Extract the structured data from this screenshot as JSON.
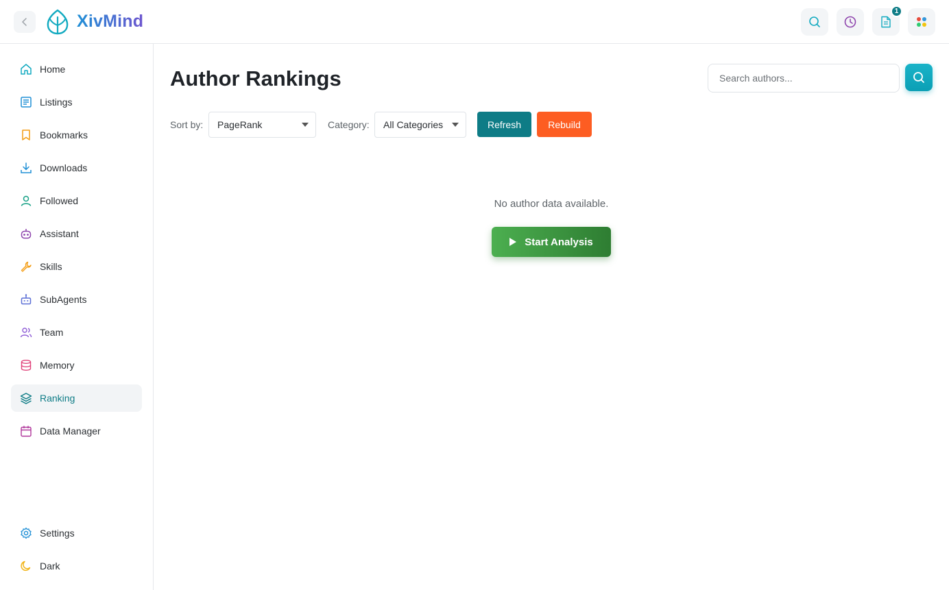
{
  "app": {
    "brand": "XivMind"
  },
  "topbar": {
    "notification_count": "1",
    "icons": [
      "search-icon",
      "history-icon",
      "document-icon",
      "apps-icon"
    ]
  },
  "sidebar": {
    "items": [
      {
        "label": "Home",
        "icon": "home-icon"
      },
      {
        "label": "Listings",
        "icon": "list-icon"
      },
      {
        "label": "Bookmarks",
        "icon": "bookmark-icon"
      },
      {
        "label": "Downloads",
        "icon": "download-icon"
      },
      {
        "label": "Followed",
        "icon": "user-icon"
      },
      {
        "label": "Assistant",
        "icon": "robot-icon"
      },
      {
        "label": "Skills",
        "icon": "wrench-icon"
      },
      {
        "label": "SubAgents",
        "icon": "bot-icon"
      },
      {
        "label": "Team",
        "icon": "team-icon"
      },
      {
        "label": "Memory",
        "icon": "database-icon"
      },
      {
        "label": "Ranking",
        "icon": "layers-icon",
        "active": true
      },
      {
        "label": "Data Manager",
        "icon": "calendar-icon"
      }
    ],
    "footer": [
      {
        "label": "Settings",
        "icon": "gear-icon"
      },
      {
        "label": "Dark",
        "icon": "moon-icon"
      }
    ]
  },
  "main": {
    "title": "Author Rankings",
    "search": {
      "placeholder": "Search authors..."
    },
    "sort_label": "Sort by:",
    "sort_value": "PageRank",
    "category_label": "Category:",
    "category_value": "All Categories",
    "refresh_label": "Refresh",
    "rebuild_label": "Rebuild",
    "empty_message": "No author data available.",
    "start_label": "Start Analysis"
  },
  "colors": {
    "accent": "#0e7c86",
    "refresh": "#0e7c86",
    "rebuild": "#fd5d22",
    "start": "#43a047",
    "search_button": "#12aac0"
  }
}
